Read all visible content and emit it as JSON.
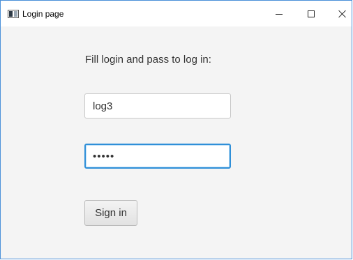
{
  "window": {
    "title": "Login page",
    "icon": "java-app-icon",
    "controls": [
      "minimize",
      "maximize",
      "close"
    ]
  },
  "form": {
    "prompt": "Fill login and pass to log in:",
    "login_value": "log3",
    "password_value": "12345",
    "signin_label": "Sign in"
  },
  "colors": {
    "focus_border": "#2f8fd8",
    "window_border": "#4a90d9",
    "background": "#f4f4f4"
  }
}
